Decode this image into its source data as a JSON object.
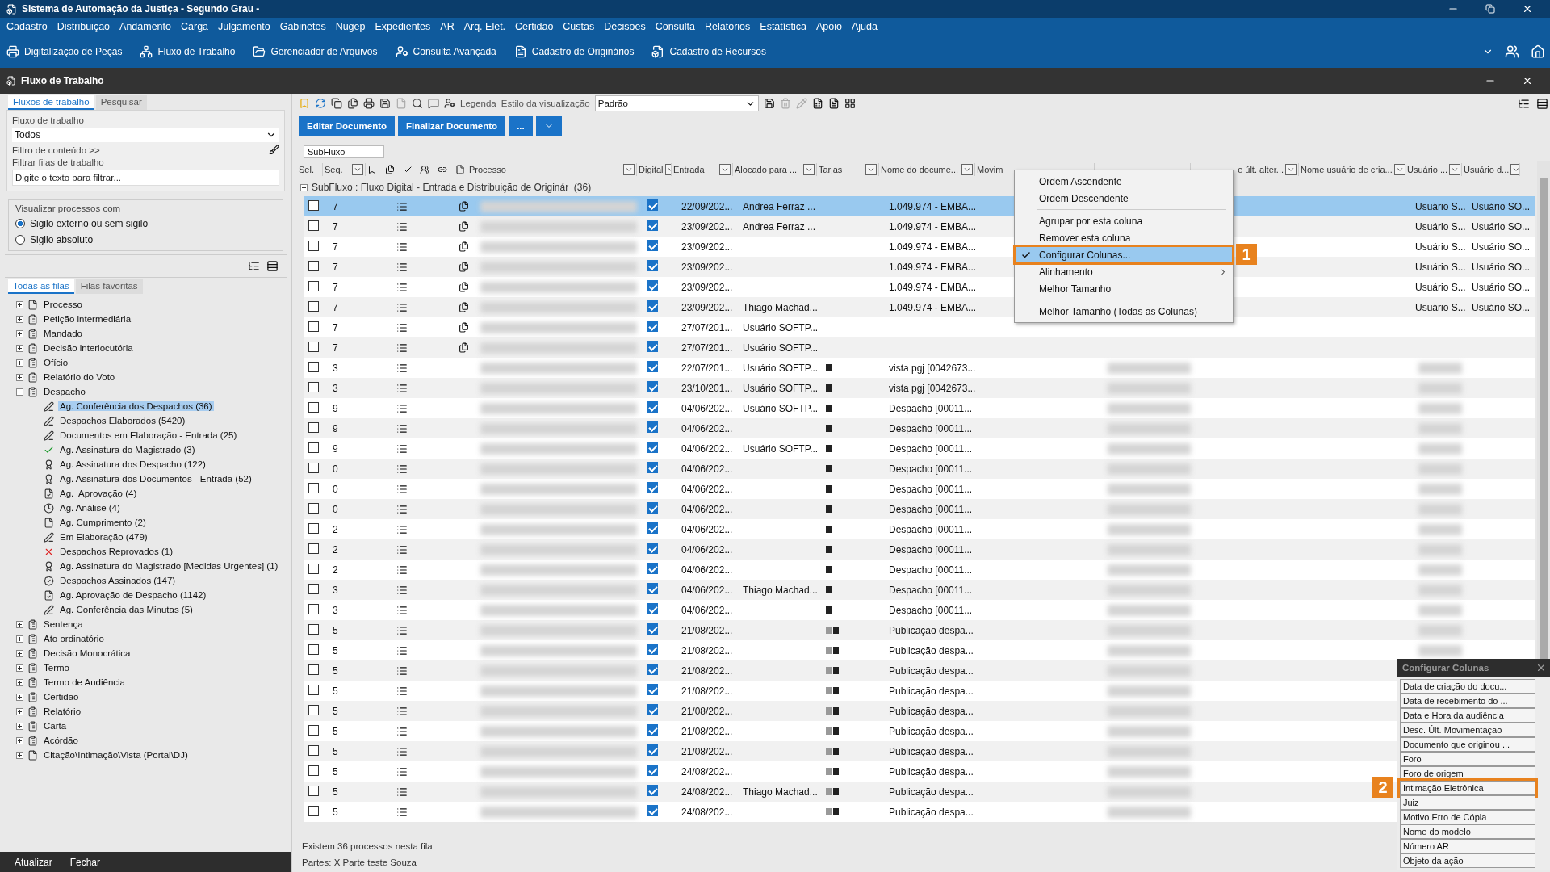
{
  "window": {
    "title": "Sistema de Automação da Justiça - Segundo Grau -"
  },
  "menu": [
    "Cadastro",
    "Distribuição",
    "Andamento",
    "Carga",
    "Julgamento",
    "Gabinetes",
    "Nugep",
    "Expedientes",
    "AR",
    "Arq. Elet.",
    "Certidão",
    "Custas",
    "Decisões",
    "Consulta",
    "Relatórios",
    "Estatística",
    "Apoio",
    "Ajuda"
  ],
  "toolbar": [
    "Digitalização de Peças",
    "Fluxo de Trabalho",
    "Gerenciador de Arquivos",
    "Consulta Avançada",
    "Cadastro de Originários",
    "Cadastro de Recursos"
  ],
  "panel": {
    "title": "Fluxo de Trabalho"
  },
  "left": {
    "tabs": [
      {
        "label": "Fluxos de trabalho",
        "selected": true
      },
      {
        "label": "Pesquisar",
        "selected": false
      }
    ],
    "workflow": {
      "label": "Fluxo de trabalho",
      "value": "Todos"
    },
    "content_filter": "Filtro de conteúdo >>",
    "queue_filter": {
      "label": "Filtrar filas de trabalho",
      "placeholder": "Digite o texto para filtrar..."
    },
    "visibility": {
      "legend": "Visualizar processos com",
      "options": [
        {
          "label": "Sigilo externo ou sem sigilo",
          "selected": true
        },
        {
          "label": "Sigilo absoluto",
          "selected": false
        }
      ]
    },
    "queue_tabs": [
      {
        "label": "Todas as filas",
        "selected": true
      },
      {
        "label": "Filas favoritas",
        "selected": false
      }
    ],
    "tree": [
      {
        "label": "Processo",
        "kind": "doc",
        "expanded": false,
        "selected": false
      },
      {
        "label": "Petição intermediária",
        "kind": "stack",
        "expanded": false,
        "selected": false
      },
      {
        "label": "Mandado",
        "kind": "stack",
        "expanded": false,
        "selected": false
      },
      {
        "label": "Decisão interlocutória",
        "kind": "stack",
        "expanded": false,
        "selected": false
      },
      {
        "label": "Ofício",
        "kind": "stack",
        "expanded": false,
        "selected": false
      },
      {
        "label": "Relatório do Voto",
        "kind": "stack",
        "expanded": false,
        "selected": false
      },
      {
        "label": "Despacho",
        "kind": "stack",
        "expanded": true,
        "selected": false,
        "children": [
          {
            "label": "Ag. Conferência dos Despachos (36)",
            "kind": "pen",
            "selected": true
          },
          {
            "label": "Despachos Elaborados (5420)",
            "kind": "pen",
            "selected": false
          },
          {
            "label": "Documentos em Elaboração - Entrada (25)",
            "kind": "pen",
            "selected": false
          },
          {
            "label": "Ag. Assinatura do Magistrado (3)",
            "kind": "check",
            "selected": false
          },
          {
            "label": "Ag. Assinatura dos Despacho (122)",
            "kind": "seal",
            "selected": false
          },
          {
            "label": "Ag. Assinatura dos Documentos - Entrada (52)",
            "kind": "seal",
            "selected": false
          },
          {
            "label": "Ag.  Aprovação (4)",
            "kind": "approve",
            "selected": false
          },
          {
            "label": "Ag. Análise (4)",
            "kind": "clock",
            "selected": false
          },
          {
            "label": "Ag. Cumprimento (2)",
            "kind": "doc",
            "selected": false
          },
          {
            "label": "Em Elaboração (479)",
            "kind": "pen",
            "selected": false
          },
          {
            "label": "Despachos Reprovados (1)",
            "kind": "cross",
            "selected": false
          },
          {
            "label": "Ag. Assinatura do Magistrado [Medidas Urgentes] (1)",
            "kind": "seal",
            "selected": false
          },
          {
            "label": "Despachos Assinados (147)",
            "kind": "certified",
            "selected": false
          },
          {
            "label": "Ag. Aprovação de Despacho (1142)",
            "kind": "approve",
            "selected": false
          },
          {
            "label": "Ag. Conferência das Minutas (5)",
            "kind": "pen",
            "selected": false
          }
        ]
      },
      {
        "label": "Sentença",
        "kind": "stack",
        "expanded": false,
        "selected": false
      },
      {
        "label": "Ato ordinatório",
        "kind": "stack",
        "expanded": false,
        "selected": false
      },
      {
        "label": "Decisão Monocrática",
        "kind": "stack",
        "expanded": false,
        "selected": false
      },
      {
        "label": "Termo",
        "kind": "stack",
        "expanded": false,
        "selected": false
      },
      {
        "label": "Termo de Audiência",
        "kind": "stack",
        "expanded": false,
        "selected": false
      },
      {
        "label": "Certidão",
        "kind": "stack",
        "expanded": false,
        "selected": false
      },
      {
        "label": "Relatório",
        "kind": "stack",
        "expanded": false,
        "selected": false
      },
      {
        "label": "Carta",
        "kind": "stack",
        "expanded": false,
        "selected": false
      },
      {
        "label": "Acórdão",
        "kind": "stack",
        "expanded": false,
        "selected": false
      },
      {
        "label": "Citação\\Intimação\\Vista (Portal\\DJ)",
        "kind": "doc",
        "expanded": false,
        "selected": false
      }
    ],
    "buttons": [
      "Atualizar",
      "Fechar"
    ]
  },
  "grid": {
    "toolbar": {
      "legend": "Legenda",
      "style_label": "Estilo da visualização",
      "style_value": "Padrão"
    },
    "actions": [
      "Editar Documento",
      "Finalizar Documento",
      "..."
    ],
    "group_chip": "SubFluxo",
    "columns": [
      {
        "kind": "text",
        "label": "Sel.",
        "filter": false
      },
      {
        "kind": "text",
        "label": "Seq.",
        "filter": true
      },
      {
        "kind": "icons"
      },
      {
        "kind": "text",
        "label": "Processo",
        "filter": true
      },
      {
        "kind": "text",
        "label": "Digital",
        "filter": true
      },
      {
        "kind": "text",
        "label": "Entrada",
        "filter": true
      },
      {
        "kind": "text",
        "label": "Alocado para ...",
        "filter": true
      },
      {
        "kind": "text",
        "label": "Tarjas",
        "filter": true
      },
      {
        "kind": "text",
        "label": "Nome do docume...",
        "filter": true
      },
      {
        "kind": "text",
        "label": "Movim",
        "filter": false
      },
      {
        "kind": "text",
        "filter": false
      },
      {
        "kind": "text",
        "label": "e últ. alter...",
        "filter": true
      },
      {
        "kind": "text",
        "label": "Nome usuário de cria...",
        "filter": true
      },
      {
        "kind": "text",
        "label": "Usuário ...",
        "filter": true
      },
      {
        "kind": "text",
        "label": "Usuário d...",
        "filter": true
      }
    ],
    "group_row": "SubFluxo : Fluxo Digital - Entrada e Distribuição de Originár  (36)",
    "rows": [
      {
        "seq": "7",
        "doc": true,
        "checked": false,
        "digital": true,
        "entrada": "22/09/202...",
        "alocado": "Andrea Ferraz ...",
        "nome": "1.049.974 - EMBA...",
        "usuario": "Usuário S...",
        "usuario_d": "Usuário SO...",
        "blurred": false,
        "selected": true
      },
      {
        "seq": "7",
        "doc": true,
        "checked": false,
        "digital": true,
        "entrada": "23/09/202...",
        "alocado": "Andrea Ferraz ...",
        "nome": "1.049.974 - EMBA...",
        "usuario": "Usuário S...",
        "usuario_d": "Usuário SO...",
        "blurred": false,
        "selected": false
      },
      {
        "seq": "7",
        "doc": true,
        "checked": false,
        "digital": true,
        "entrada": "23/09/202...",
        "nome": "1.049.974 - EMBA...",
        "usuario": "Usuário S...",
        "usuario_d": "Usuário SO...",
        "blurred": false,
        "selected": false
      },
      {
        "seq": "7",
        "doc": true,
        "checked": false,
        "digital": true,
        "entrada": "23/09/202...",
        "nome": "1.049.974 - EMBA...",
        "usuario": "Usuário S...",
        "usuario_d": "Usuário SO...",
        "blurred": false,
        "selected": false
      },
      {
        "seq": "7",
        "doc": true,
        "checked": false,
        "digital": true,
        "entrada": "23/09/202...",
        "nome": "1.049.974 - EMBA...",
        "usuario": "Usuário S...",
        "usuario_d": "Usuário SO...",
        "blurred": false,
        "selected": false
      },
      {
        "seq": "7",
        "doc": true,
        "checked": false,
        "digital": true,
        "entrada": "23/09/202...",
        "alocado": "Thiago Machad...",
        "nome": "1.049.974 - EMBA...",
        "usuario": "Usuário S...",
        "usuario_d": "Usuário SO...",
        "blurred": false,
        "selected": false
      },
      {
        "seq": "7",
        "doc": true,
        "checked": false,
        "digital": true,
        "entrada": "27/07/201...",
        "alocado": "Usuário SOFTP...",
        "blurred": false,
        "selected": false
      },
      {
        "seq": "7",
        "doc": true,
        "checked": false,
        "digital": true,
        "entrada": "27/07/201...",
        "alocado": "Usuário SOFTP...",
        "blurred": false,
        "selected": false
      },
      {
        "seq": "3",
        "doc": false,
        "checked": false,
        "digital": true,
        "entrada": "22/07/201...",
        "alocado": "Usuário SOFTP...",
        "tarjas": [
          {
            "color": "#222222"
          }
        ],
        "nome": "vista pgj [0042673...",
        "blurred": true,
        "selected": false
      },
      {
        "seq": "3",
        "doc": false,
        "checked": false,
        "digital": true,
        "entrada": "23/10/201...",
        "alocado": "Usuário SOFTP...",
        "tarjas": [
          {
            "color": "#222222"
          }
        ],
        "nome": "vista pgj [0042673...",
        "blurred": true,
        "selected": false
      },
      {
        "seq": "9",
        "doc": false,
        "checked": false,
        "digital": true,
        "entrada": "04/06/202...",
        "alocado": "Usuário SOFTP...",
        "tarjas": [
          {
            "color": "#222222"
          }
        ],
        "nome": "Despacho [00011...",
        "blurred": true,
        "selected": false
      },
      {
        "seq": "9",
        "doc": false,
        "checked": false,
        "digital": true,
        "entrada": "04/06/202...",
        "tarjas": [
          {
            "color": "#222222"
          }
        ],
        "nome": "Despacho [00011...",
        "blurred": true,
        "selected": false
      },
      {
        "seq": "9",
        "doc": false,
        "checked": false,
        "digital": true,
        "entrada": "04/06/202...",
        "alocado": "Usuário SOFTP...",
        "tarjas": [
          {
            "color": "#222222"
          }
        ],
        "nome": "Despacho [00011...",
        "blurred": true,
        "selected": false
      },
      {
        "seq": "0",
        "doc": false,
        "checked": false,
        "digital": true,
        "entrada": "04/06/202...",
        "tarjas": [
          {
            "color": "#222222"
          }
        ],
        "nome": "Despacho [00011...",
        "blurred": true,
        "selected": false
      },
      {
        "seq": "0",
        "doc": false,
        "checked": false,
        "digital": true,
        "entrada": "04/06/202...",
        "tarjas": [
          {
            "color": "#222222"
          }
        ],
        "nome": "Despacho [00011...",
        "blurred": true,
        "selected": false
      },
      {
        "seq": "0",
        "doc": false,
        "checked": false,
        "digital": true,
        "entrada": "04/06/202...",
        "tarjas": [
          {
            "color": "#222222"
          }
        ],
        "nome": "Despacho [00011...",
        "blurred": true,
        "selected": false
      },
      {
        "seq": "2",
        "doc": false,
        "checked": false,
        "digital": true,
        "entrada": "04/06/202...",
        "tarjas": [
          {
            "color": "#222222"
          }
        ],
        "nome": "Despacho [00011...",
        "blurred": true,
        "selected": false
      },
      {
        "seq": "2",
        "doc": false,
        "checked": false,
        "digital": true,
        "entrada": "04/06/202...",
        "tarjas": [
          {
            "color": "#222222"
          }
        ],
        "nome": "Despacho [00011...",
        "blurred": true,
        "selected": false
      },
      {
        "seq": "2",
        "doc": false,
        "checked": false,
        "digital": true,
        "entrada": "04/06/202...",
        "tarjas": [
          {
            "color": "#222222"
          }
        ],
        "nome": "Despacho [00011...",
        "blurred": true,
        "selected": false
      },
      {
        "seq": "3",
        "doc": false,
        "checked": false,
        "digital": true,
        "entrada": "04/06/202...",
        "alocado": "Thiago Machad...",
        "tarjas": [
          {
            "color": "#222222"
          }
        ],
        "nome": "Despacho [00011...",
        "blurred": true,
        "selected": false
      },
      {
        "seq": "3",
        "doc": false,
        "checked": false,
        "digital": true,
        "entrada": "04/06/202...",
        "tarjas": [
          {
            "color": "#222222"
          }
        ],
        "nome": "Despacho [00011...",
        "blurred": true,
        "selected": false
      },
      {
        "seq": "5",
        "doc": false,
        "checked": false,
        "digital": true,
        "entrada": "21/08/202...",
        "tarjas": [
          {
            "color": "#999999"
          },
          {
            "color": "#222222"
          }
        ],
        "nome": "Publicação despa...",
        "blurred": true,
        "selected": false
      },
      {
        "seq": "5",
        "doc": false,
        "checked": false,
        "digital": true,
        "entrada": "21/08/202...",
        "tarjas": [
          {
            "color": "#999999"
          },
          {
            "color": "#222222"
          }
        ],
        "nome": "Publicação despa...",
        "blurred": true,
        "selected": false
      },
      {
        "seq": "5",
        "doc": false,
        "checked": false,
        "digital": true,
        "entrada": "21/08/202...",
        "tarjas": [
          {
            "color": "#999999"
          },
          {
            "color": "#222222"
          }
        ],
        "nome": "Publicação despa...",
        "blurred": true,
        "selected": false
      },
      {
        "seq": "5",
        "doc": false,
        "checked": false,
        "digital": true,
        "entrada": "21/08/202...",
        "tarjas": [
          {
            "color": "#999999"
          },
          {
            "color": "#222222"
          }
        ],
        "nome": "Publicação despa...",
        "blurred": true,
        "selected": false
      },
      {
        "seq": "5",
        "doc": false,
        "checked": false,
        "digital": true,
        "entrada": "21/08/202...",
        "tarjas": [
          {
            "color": "#999999"
          },
          {
            "color": "#222222"
          }
        ],
        "nome": "Publicação despa...",
        "blurred": true,
        "selected": false
      },
      {
        "seq": "5",
        "doc": false,
        "checked": false,
        "digital": true,
        "entrada": "21/08/202...",
        "tarjas": [
          {
            "color": "#999999"
          },
          {
            "color": "#222222"
          }
        ],
        "nome": "Publicação despa...",
        "blurred": true,
        "selected": false
      },
      {
        "seq": "5",
        "doc": false,
        "checked": false,
        "digital": true,
        "entrada": "21/08/202...",
        "tarjas": [
          {
            "color": "#999999"
          },
          {
            "color": "#222222"
          }
        ],
        "nome": "Publicação despa...",
        "blurred": true,
        "selected": false
      },
      {
        "seq": "5",
        "doc": false,
        "checked": false,
        "digital": true,
        "entrada": "24/08/202...",
        "tarjas": [
          {
            "color": "#999999"
          },
          {
            "color": "#222222"
          }
        ],
        "nome": "Publicação despa...",
        "blurred": true,
        "selected": false
      },
      {
        "seq": "5",
        "doc": false,
        "checked": false,
        "digital": true,
        "entrada": "24/08/202...",
        "alocado": "Thiago Machad...",
        "tarjas": [
          {
            "color": "#999999"
          },
          {
            "color": "#222222"
          }
        ],
        "nome": "Publicação despa...",
        "blurred": true,
        "selected": false
      },
      {
        "seq": "5",
        "doc": false,
        "checked": false,
        "digital": true,
        "entrada": "24/08/202...",
        "tarjas": [
          {
            "color": "#999999"
          },
          {
            "color": "#222222"
          }
        ],
        "nome": "Publicação despa...",
        "blurred": true,
        "selected": false
      }
    ],
    "status": "Existem 36 processos nesta fila",
    "parties": {
      "label": "Partes:",
      "value": "X Parte teste Souza"
    }
  },
  "context_menu": [
    [
      {
        "label": "Ordem Ascendente",
        "checked": false,
        "highlighted": false,
        "submenu": false
      },
      {
        "label": "Ordem Descendente",
        "checked": false,
        "highlighted": false,
        "submenu": false
      }
    ],
    [
      {
        "label": "Agrupar por esta coluna",
        "checked": false,
        "highlighted": false,
        "submenu": false
      },
      {
        "label": "Remover esta coluna",
        "checked": false,
        "highlighted": false,
        "submenu": false
      },
      {
        "label": "Configurar Colunas...",
        "checked": true,
        "highlighted": true,
        "submenu": false,
        "annotation": "1"
      },
      {
        "label": "Alinhamento",
        "checked": false,
        "highlighted": false,
        "submenu": true
      },
      {
        "label": "Melhor Tamanho",
        "checked": false,
        "highlighted": false,
        "submenu": false
      }
    ],
    [
      {
        "label": "Melhor Tamanho (Todas as Colunas)",
        "checked": false,
        "highlighted": false,
        "submenu": false
      }
    ]
  ],
  "column_config": {
    "title": "Configurar Colunas",
    "items": [
      {
        "label": "Data de criação do docu..."
      },
      {
        "label": "Data de recebimento do ..."
      },
      {
        "label": "Data e Hora da audiência"
      },
      {
        "label": "Desc. Últ. Movimentação"
      },
      {
        "label": "Documento que originou ..."
      },
      {
        "label": "Foro"
      },
      {
        "label": "Foro de origem"
      },
      {
        "label": "Intimação Eletrônica",
        "annotation": "2"
      },
      {
        "label": "Juiz"
      },
      {
        "label": "Motivo Erro de Cópia"
      },
      {
        "label": "Nome do modelo"
      },
      {
        "label": "Número AR"
      },
      {
        "label": "Objeto da ação"
      }
    ]
  }
}
